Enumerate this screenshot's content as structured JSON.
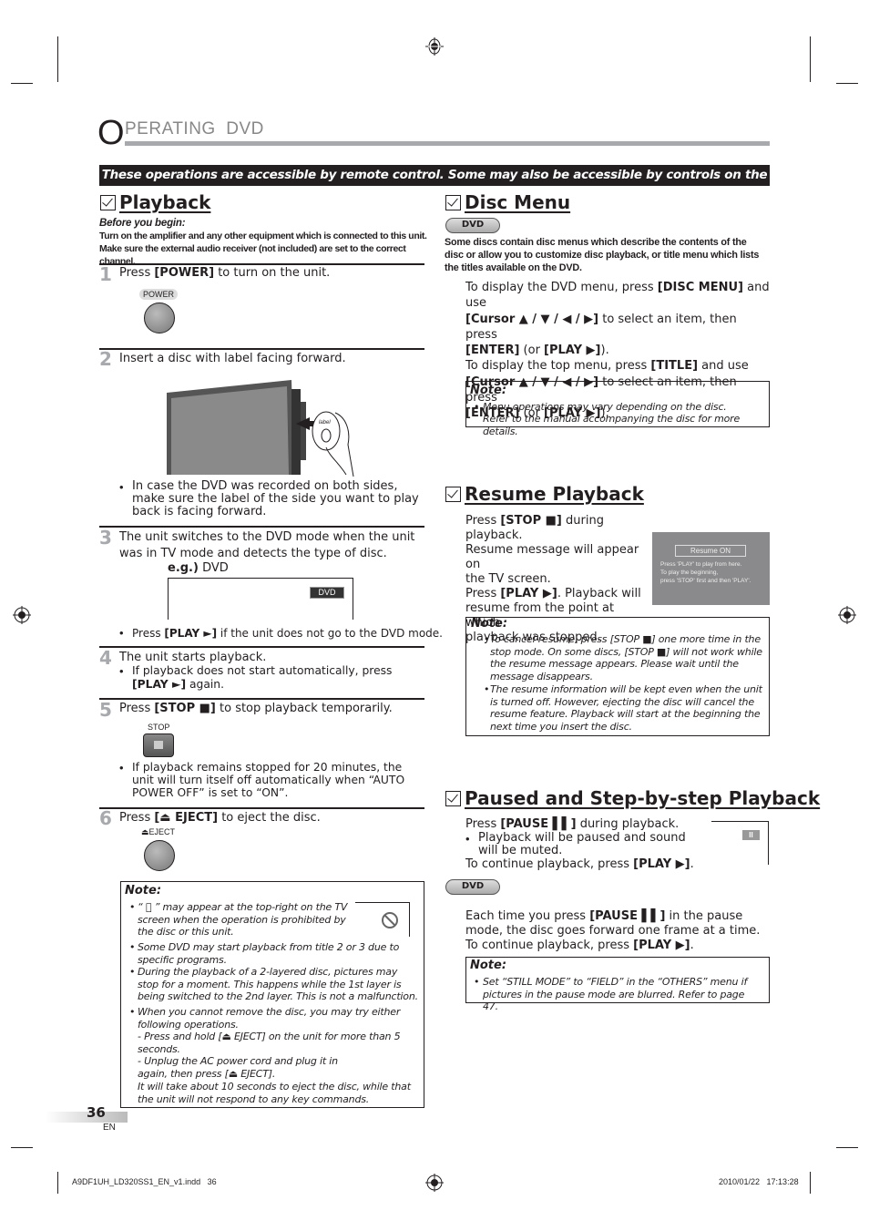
{
  "header": {
    "title_initial": "O",
    "title_rest": "PERATING  DVD",
    "banner": "These operations are accessible by remote control. Some may also be accessible by controls on the main unit."
  },
  "playback": {
    "heading": "Playback",
    "before_title": "Before you begin:",
    "before_lines": [
      "Turn on the amplifier and any other equipment which is connected to this unit.",
      "Make sure the external audio receiver (not included) are set to the correct channel."
    ],
    "steps": [
      {
        "num": "1",
        "pre": "Press ",
        "key": "[POWER]",
        "post": " to turn on the unit.",
        "button_label": "POWER"
      },
      {
        "num": "2",
        "text": "Insert a disc with label facing forward.",
        "disc_label": "label",
        "bullet": "In case the DVD was recorded on both sides, make sure the label of the side you want to play back is facing forward."
      },
      {
        "num": "3",
        "text": "The unit switches to the DVD mode when the unit was in TV mode and detects the type of disc.",
        "eg_key": "e.g.)",
        "eg_val": " DVD",
        "osd": "DVD",
        "bullet_pre": "Press ",
        "bullet_key": "[PLAY ►]",
        "bullet_post": " if the unit does not go to the DVD mode."
      },
      {
        "num": "4",
        "text": "The unit starts playback.",
        "bullet_pre": "If playback does not start automatically, press ",
        "bullet_key": "[PLAY ►]",
        "bullet_post": " again."
      },
      {
        "num": "5",
        "pre": "Press ",
        "key": "[STOP ■]",
        "post": " to stop playback temporarily.",
        "button_label": "STOP",
        "bullet": "If playback remains stopped for 20 minutes, the unit will turn itself off automatically when “AUTO POWER OFF” is set to “ON”."
      },
      {
        "num": "6",
        "pre": "Press ",
        "key": "[⏏ EJECT]",
        "post": " to eject the disc.",
        "button_label": "⏏EJECT"
      }
    ],
    "note": {
      "title": "Note:",
      "items": [
        "“ ⃠ ” may appear at the top-right on the TV screen when the operation is prohibited by the disc or this unit.",
        "Some DVD may start playback from title 2 or 3 due to specific programs.",
        "During the playback of a 2-layered disc, pictures may stop for a moment. This happens while the 1st layer is being switched to the 2nd layer. This is not a malfunction.",
        "When you cannot remove the disc, you may try either following operations.",
        "- Press and hold [⏏ EJECT] on the unit for more than 5 seconds.",
        "- Unplug the AC power cord and plug it in again, then press [⏏ EJECT].",
        "It will take about 10 seconds to eject the disc, while that the unit will not respond to any key commands."
      ]
    }
  },
  "disc_menu": {
    "heading": "Disc Menu",
    "badge": "DVD",
    "intro": "Some discs contain disc menus which describe the contents of the disc or allow you to customize disc playback, or title menu which lists the titles available on the DVD.",
    "lines": [
      [
        "To display the DVD menu, press ",
        "[DISC MENU]",
        " and use"
      ],
      [
        "",
        "[Cursor ▲ / ▼ / ◀ / ▶]",
        " to select an item, then press"
      ],
      [
        "",
        "[ENTER]",
        " (or "
      ],
      [
        "To display the top menu, press ",
        "[TITLE]",
        " and use"
      ],
      [
        "",
        "[Cursor ▲ / ▼ / ◀ / ▶]",
        " to select an item, then press"
      ],
      [
        "",
        "[ENTER]",
        " (or "
      ]
    ],
    "play_key": "[PLAY ▶]",
    "close": ").",
    "note": {
      "title": "Note:",
      "items": [
        "Menu operations may vary depending on the disc.",
        "Refer to the manual accompanying the disc for more details."
      ]
    }
  },
  "resume": {
    "heading": "Resume Playback",
    "lines": [
      [
        "Press ",
        "[STOP ■]",
        " during playback."
      ],
      [
        "Resume message will appear on",
        "",
        ""
      ],
      [
        "the TV screen.",
        "",
        ""
      ],
      [
        "Press ",
        "[PLAY ▶]",
        ". Playback will"
      ],
      [
        "resume from the point at which",
        "",
        ""
      ],
      [
        "playback was stopped.",
        "",
        ""
      ]
    ],
    "osd_title": "Resume ON",
    "osd_msg": "Press 'PLAY' to play from here.\nTo play the beginning,\npress 'STOP' first and then 'PLAY'.",
    "note": {
      "title": "Note:",
      "items": [
        "To cancel resume, press [STOP ■] one more time in the stop mode. On some discs, [STOP ■] will not work while the resume message appears. Please wait until the message disappears.",
        "The resume information will be kept even when the unit is turned off. However, ejecting the disc will cancel the resume feature. Playback will start at the beginning the next time you insert the disc."
      ]
    }
  },
  "pause": {
    "heading": "Paused and Step-by-step Playback",
    "line1_pre": "Press ",
    "line1_key": "[PAUSE ▌▌]",
    "line1_post": " during playback.",
    "bullet": "Playback will be paused and sound will be muted.",
    "continue_pre": "To continue playback, press ",
    "continue_key": "[PLAY ▶]",
    "continue_post": ".",
    "osd": "II",
    "badge": "DVD",
    "step_pre": "Each time you press ",
    "step_key": "[PAUSE ▌▌]",
    "step_post": " in the pause mode, the disc goes forward one frame at a time.",
    "note": {
      "title": "Note:",
      "items": [
        "Set “STILL MODE” to “FIELD” in the “OTHERS” menu if pictures in the pause mode are blurred. Refer to page 47."
      ]
    }
  },
  "footer": {
    "page_number": "36",
    "lang": "EN",
    "file": "A9DF1UH_LD320SS1_EN_v1.indd   36",
    "timestamp": "2010/01/22   17:13:28"
  }
}
